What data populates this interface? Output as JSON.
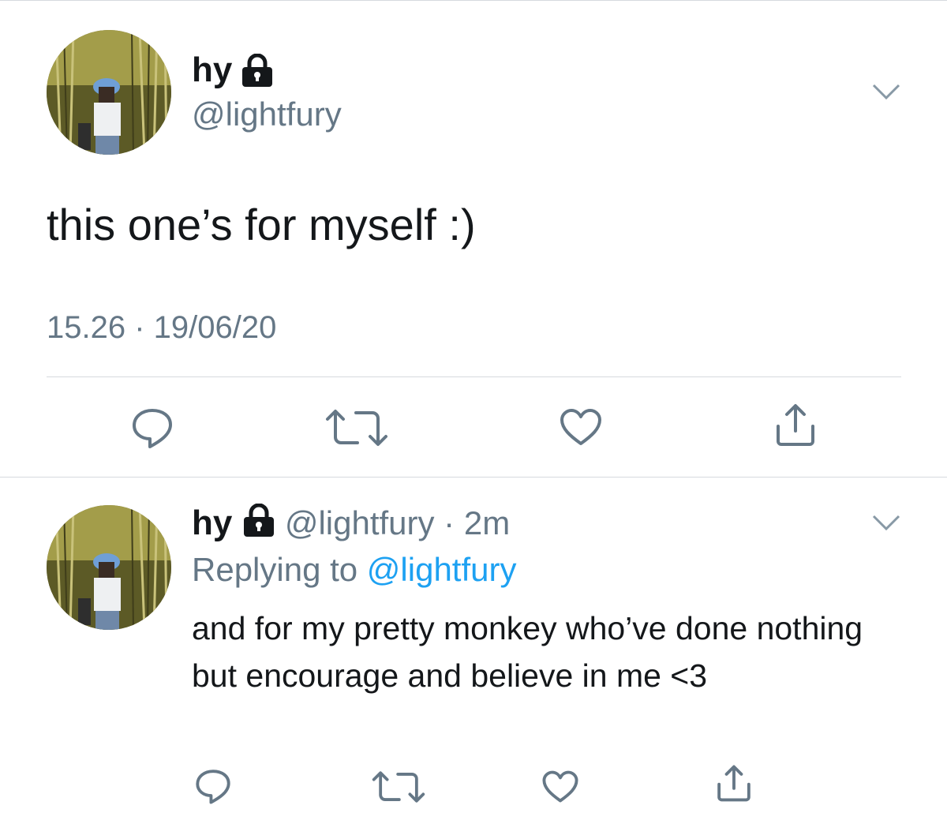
{
  "main_tweet": {
    "display_name": "hy",
    "handle": "@lightfury",
    "text": "this one’s for myself :)",
    "time": "15.26",
    "date": "19/06/20",
    "separator": " · ",
    "icons": [
      "lock-icon",
      "chevron-down-icon",
      "reply-icon",
      "retweet-icon",
      "like-icon",
      "share-icon"
    ]
  },
  "reply_tweet": {
    "display_name": "hy",
    "handle": "@lightfury",
    "age": "2m",
    "separator": " · ",
    "replying_label": "Replying to",
    "replying_handle": "@lightfury",
    "text": "and for my pretty monkey who’ve done nothing but encourage and believe in me <3"
  },
  "colors": {
    "text": "#14171a",
    "secondary": "#657786",
    "link": "#1da1f2",
    "icon": "#657786",
    "divider": "#d6dade"
  }
}
